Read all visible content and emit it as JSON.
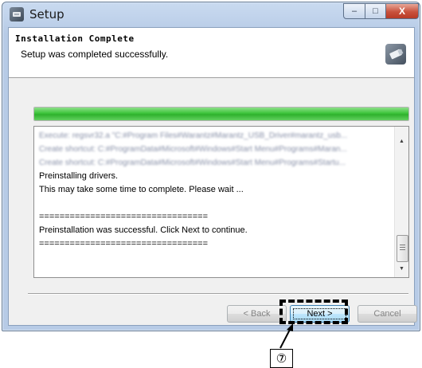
{
  "window": {
    "title": "Setup",
    "controls": {
      "minimize": "–",
      "maximize": "□",
      "close": "X"
    }
  },
  "header": {
    "title": "Installation Complete",
    "subtitle": "Setup was completed successfully."
  },
  "progress": {
    "value_percent": 100,
    "color": "#3cc43a"
  },
  "log": {
    "lines": [
      {
        "text": "Execute: regsvr32.a \"C:#Program Files#Warantz#Marantz_USB_Driver#marantz_usb...",
        "blurred": true
      },
      {
        "text": "Create shortcut: C:#ProgramData#Microsoft#Windows#Start Menu#Programs#Maran...",
        "blurred": true
      },
      {
        "text": "Create shortcut: C:#ProgramData#Microsoft#Windows#Start Menu#Programs#Startu...",
        "blurred": true
      },
      {
        "text": "Preinstalling drivers.",
        "blurred": false
      },
      {
        "text": "This may take some time to complete. Please wait ...",
        "blurred": false
      },
      {
        "text": "",
        "blurred": false
      },
      {
        "text": "=================================",
        "blurred": false
      },
      {
        "text": "Preinstallation was successful. Click Next to continue.",
        "blurred": false
      },
      {
        "text": "=================================",
        "blurred": false
      }
    ]
  },
  "buttons": {
    "back": "< Back",
    "next": "Next >",
    "cancel": "Cancel"
  },
  "annotation": {
    "callout_label": "⑦"
  },
  "colors": {
    "titlebar": "#b7cbe6",
    "close_button": "#c8523c",
    "progress_fill": "#3cc43a",
    "next_button": "#bee6fd"
  }
}
